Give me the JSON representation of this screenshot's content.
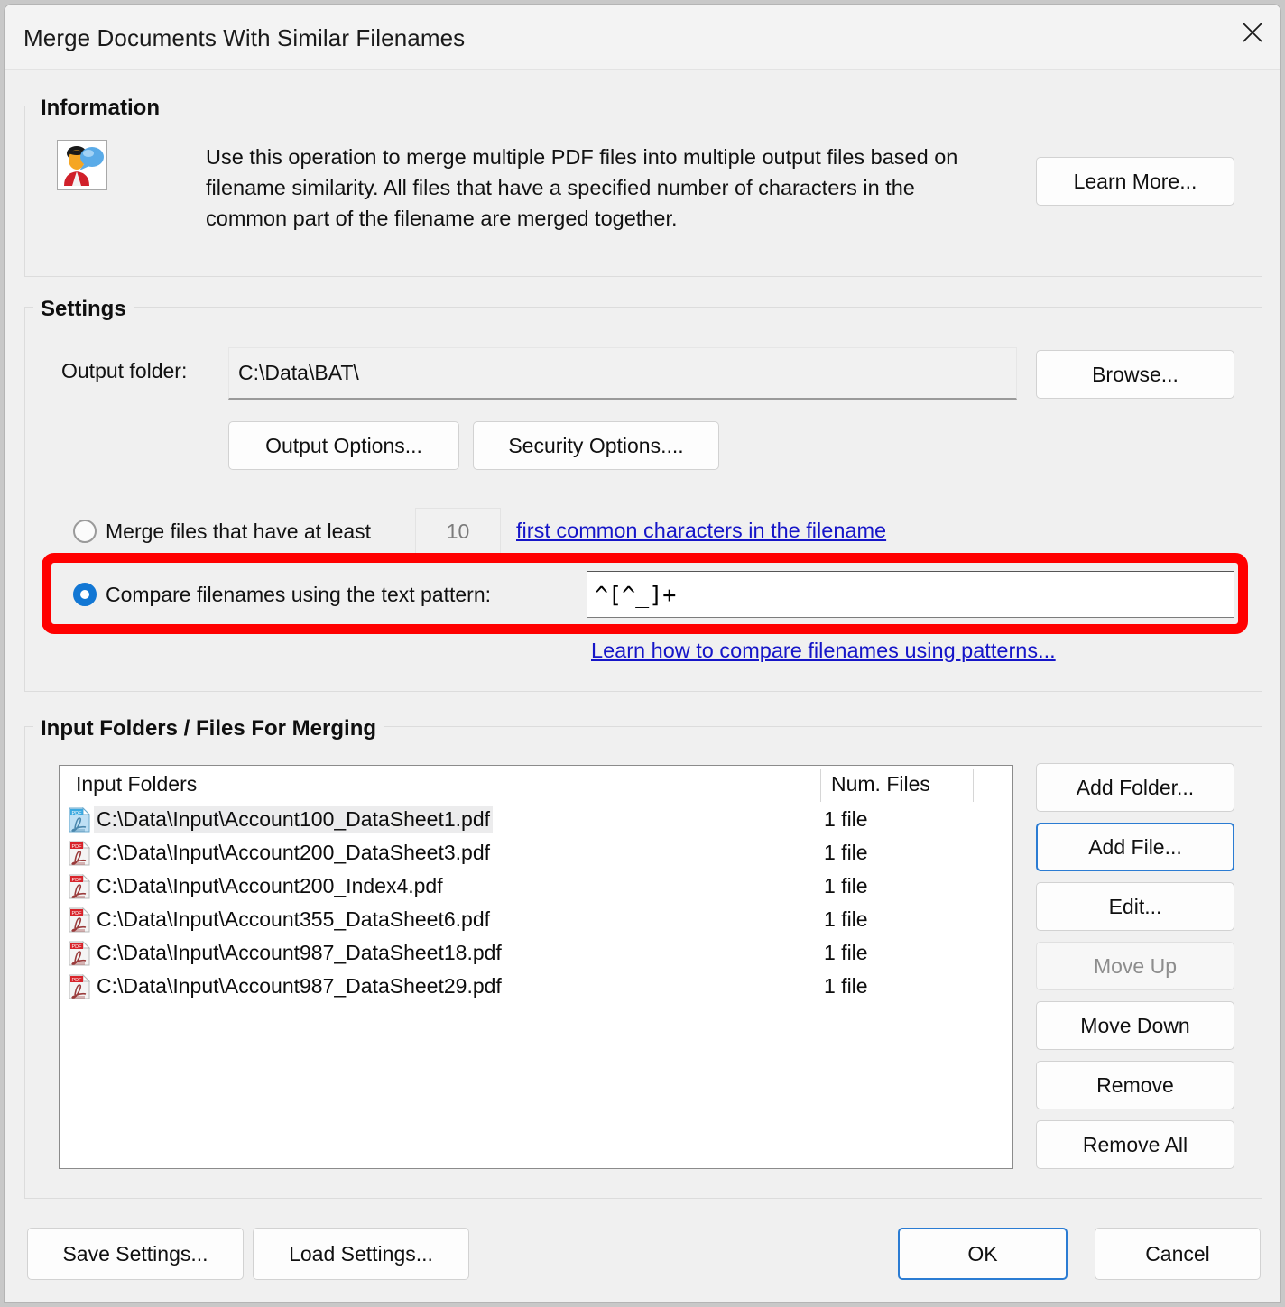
{
  "window": {
    "title": "Merge Documents With Similar Filenames",
    "close_icon": "close-icon"
  },
  "information": {
    "group_title": "Information",
    "icon": "user-speech-bubble-icon",
    "description": "Use this operation to merge multiple PDF files into multiple output files based on filename similarity. All files that have a specified number of characters in the common part of the filename are merged together.",
    "learn_more_label": "Learn More..."
  },
  "settings": {
    "group_title": "Settings",
    "output_folder_label": "Output folder:",
    "output_folder_value": "C:\\Data\\BAT\\",
    "output_folder_placeholder": "",
    "browse_label": "Browse...",
    "output_options_label": "Output Options...",
    "security_options_label": "Security Options....",
    "merge_radio": {
      "selected": false,
      "label_before": "Merge files that have at least",
      "count_value": "10",
      "link_label": "first common characters in the filename"
    },
    "pattern_radio": {
      "selected": true,
      "label": "Compare filenames using the text pattern:",
      "pattern_value": "^[^_]+",
      "pattern_placeholder": ""
    },
    "pattern_help_link": "Learn how to compare filenames using patterns..."
  },
  "input_section": {
    "group_title": "Input Folders / Files For Merging",
    "columns": [
      "Input Folders",
      "Num. Files"
    ],
    "rows": [
      {
        "name": "C:\\Data\\Input\\Account100_DataSheet1.pdf",
        "count": "1 file",
        "selected": true,
        "icon": "pdf-file-icon"
      },
      {
        "name": "C:\\Data\\Input\\Account200_DataSheet3.pdf",
        "count": "1 file",
        "selected": false,
        "icon": "pdf-file-icon"
      },
      {
        "name": "C:\\Data\\Input\\Account200_Index4.pdf",
        "count": "1 file",
        "selected": false,
        "icon": "pdf-file-icon"
      },
      {
        "name": "C:\\Data\\Input\\Account355_DataSheet6.pdf",
        "count": "1 file",
        "selected": false,
        "icon": "pdf-file-icon"
      },
      {
        "name": "C:\\Data\\Input\\Account987_DataSheet18.pdf",
        "count": "1 file",
        "selected": false,
        "icon": "pdf-file-icon"
      },
      {
        "name": "C:\\Data\\Input\\Account987_DataSheet29.pdf",
        "count": "1 file",
        "selected": false,
        "icon": "pdf-file-icon"
      }
    ],
    "side_buttons": [
      {
        "label": "Add Folder...",
        "state": "normal"
      },
      {
        "label": "Add File...",
        "state": "focus"
      },
      {
        "label": "Edit...",
        "state": "normal"
      },
      {
        "label": "Move Up",
        "state": "disabled"
      },
      {
        "label": "Move Down",
        "state": "normal"
      },
      {
        "label": "Remove",
        "state": "normal"
      },
      {
        "label": "Remove All",
        "state": "normal"
      }
    ]
  },
  "footer": {
    "save_settings_label": "Save Settings...",
    "load_settings_label": "Load Settings...",
    "ok_label": "OK",
    "cancel_label": "Cancel"
  },
  "colors": {
    "accent": "#1277d4",
    "link": "#1515c8",
    "highlight": "#ff0000",
    "dialog_bg": "#f0f0f0"
  }
}
